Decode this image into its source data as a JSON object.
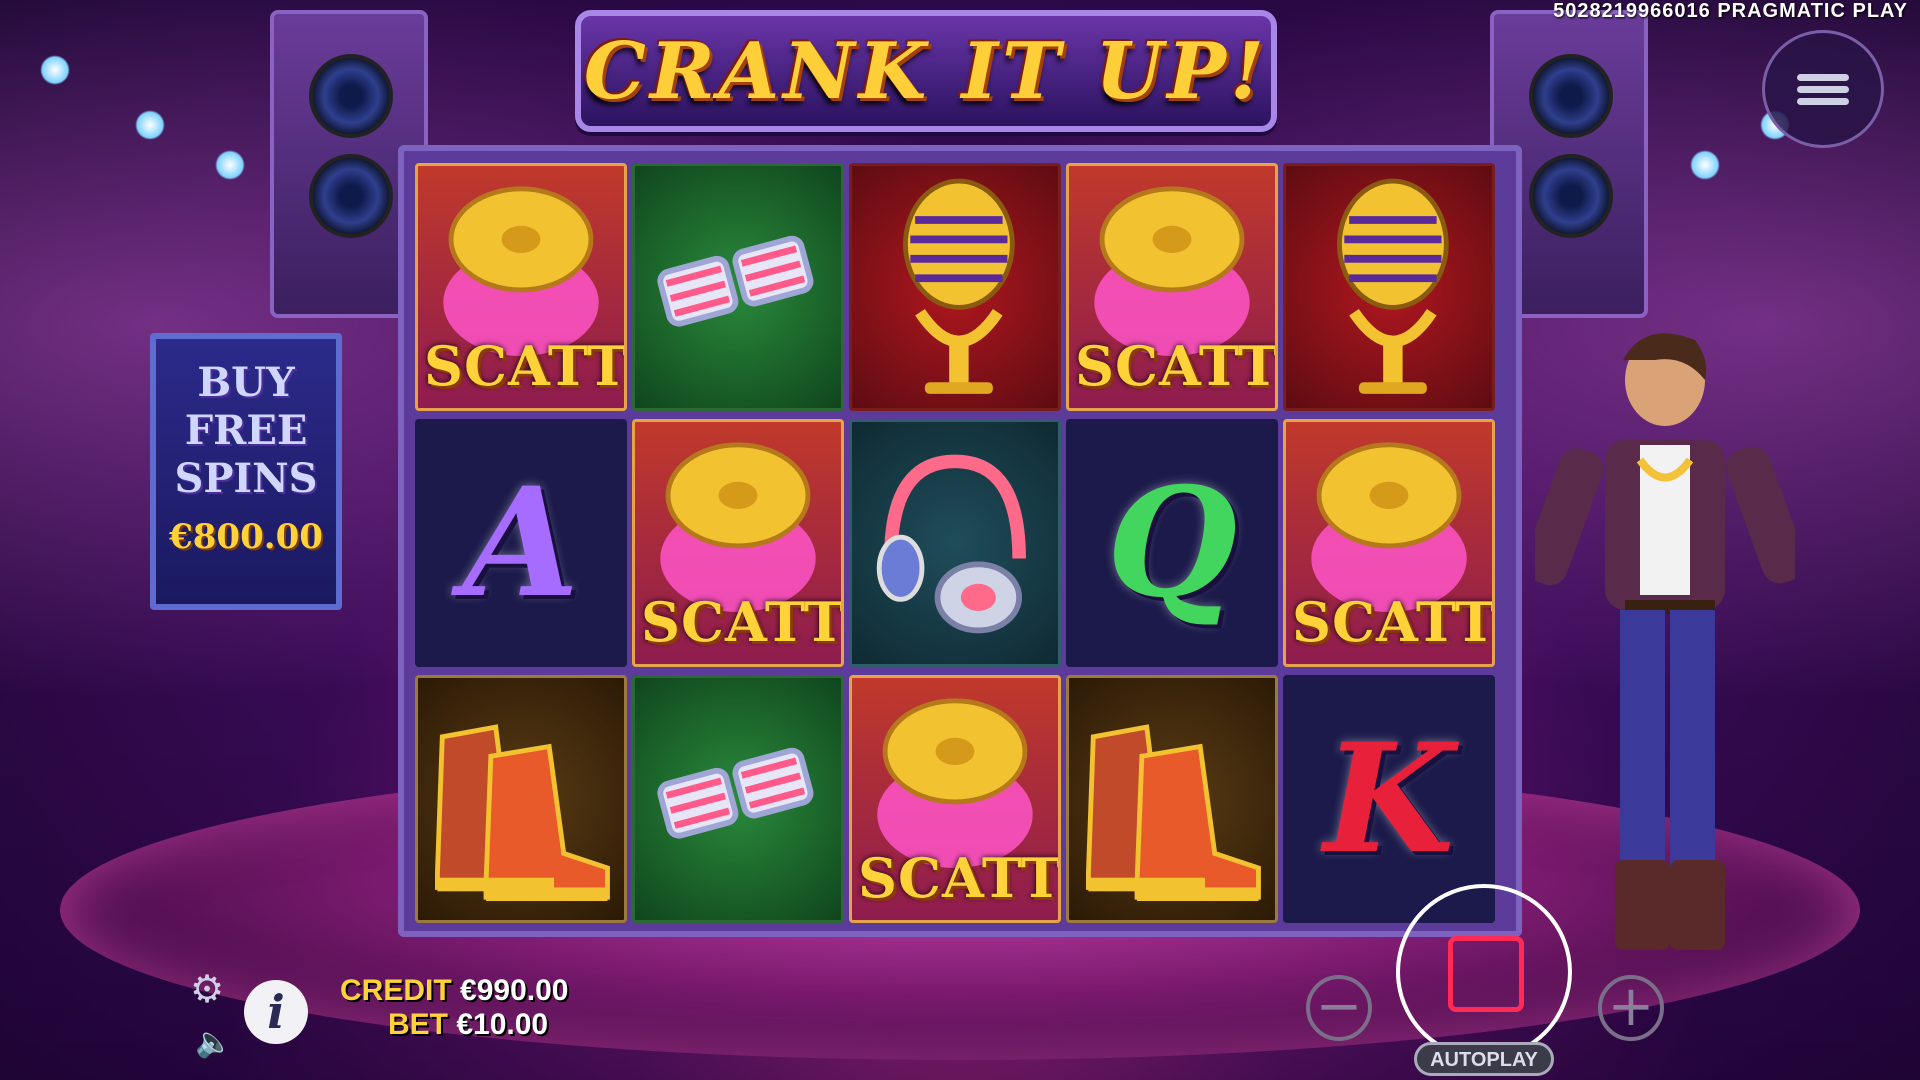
{
  "game": {
    "title": "CRANK IT UP!",
    "game_id": "5028219966016 PRAGMATIC PLAY"
  },
  "buy_feature": {
    "lines": [
      "BUY",
      "FREE",
      "SPINS"
    ],
    "price": "€800.00"
  },
  "reels": {
    "symbols": [
      [
        "scatter",
        "glasses",
        "microphone",
        "scatter",
        "microphone"
      ],
      [
        "A",
        "scatter",
        "headphones",
        "Q",
        "scatter"
      ],
      [
        "sneakers",
        "glasses",
        "scatter",
        "sneakers",
        "K"
      ]
    ],
    "scatter_label": "SCATTER"
  },
  "hud": {
    "credit_label": "CREDIT",
    "credit_value": "€990.00",
    "bet_label": "BET",
    "bet_value": "€10.00",
    "autoplay_label": "AUTOPLAY",
    "minus": "−",
    "plus": "+",
    "info": "i"
  },
  "icons": {
    "menu": "hamburger-icon",
    "settings": "gear-icon",
    "sound": "speaker-icon",
    "spin": "spin-icon"
  },
  "colors": {
    "accent_gold": "#ffd23a",
    "spin_red": "#ff2a55"
  }
}
